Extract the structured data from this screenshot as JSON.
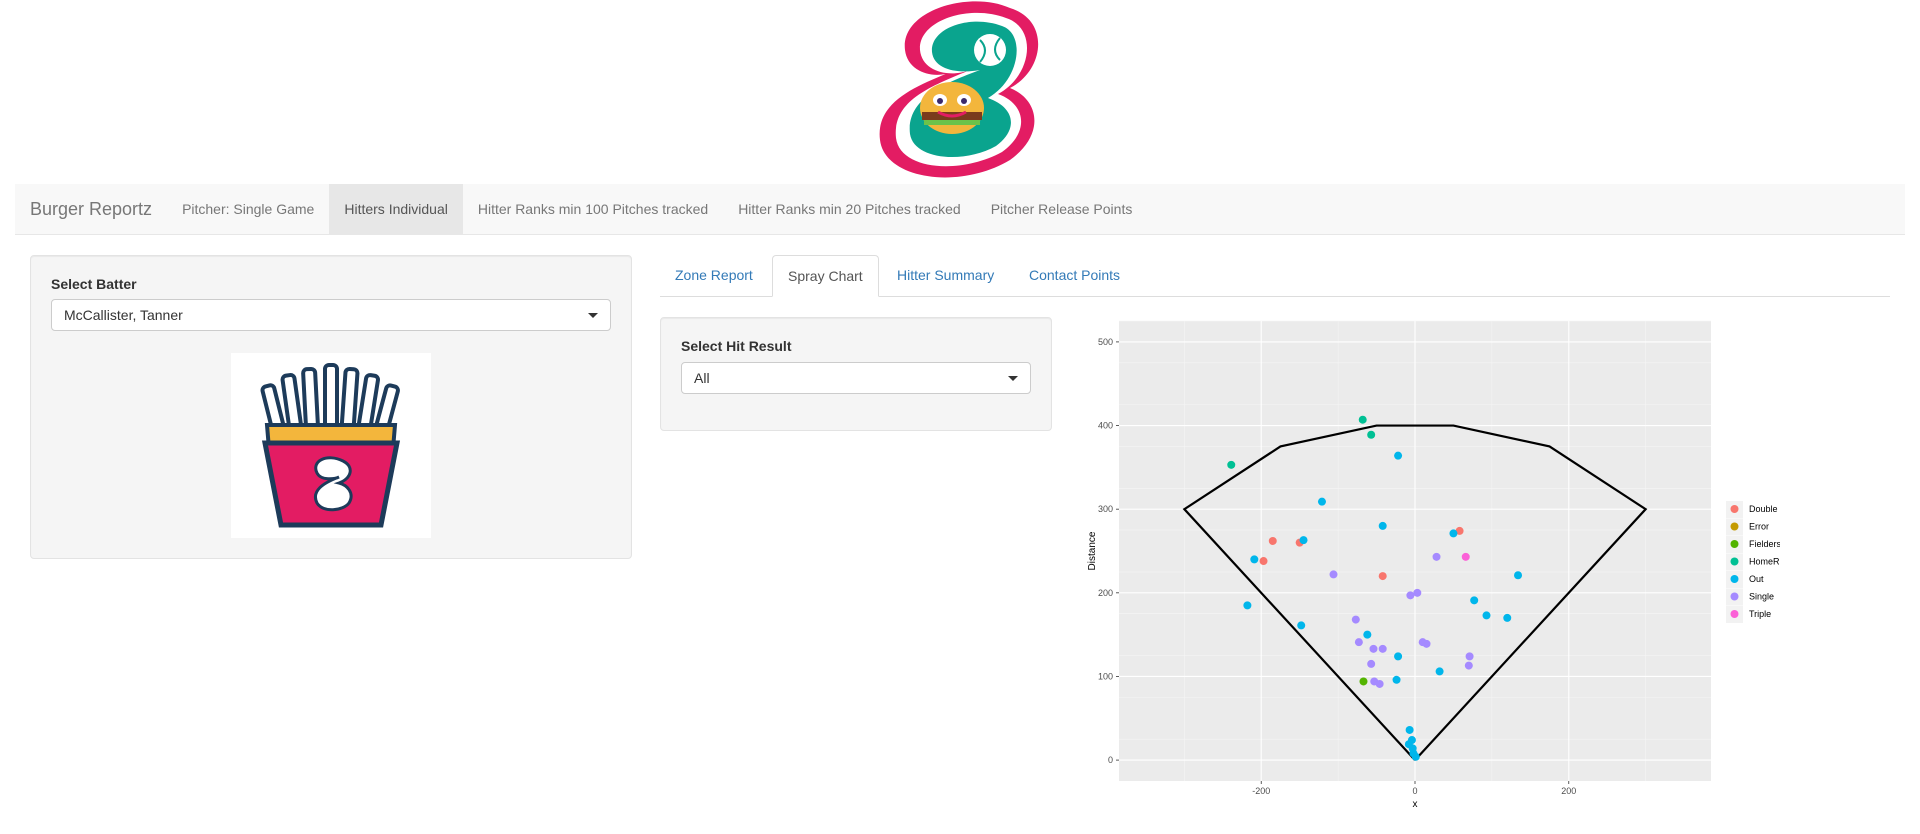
{
  "navbar": {
    "brand": "Burger Reportz",
    "items": [
      {
        "label": "Pitcher: Single Game",
        "active": false
      },
      {
        "label": "Hitters Individual",
        "active": true
      },
      {
        "label": "Hitter Ranks min 100 Pitches tracked",
        "active": false
      },
      {
        "label": "Hitter Ranks min 20 Pitches tracked",
        "active": false
      },
      {
        "label": "Pitcher Release Points",
        "active": false
      }
    ]
  },
  "sidebar": {
    "batter_label": "Select Batter",
    "batter_value": "McCallister, Tanner"
  },
  "tabs": [
    "Zone Report",
    "Spray Chart",
    "Hitter Summary",
    "Contact Points"
  ],
  "active_tab": "Spray Chart",
  "filter": {
    "label": "Select Hit Result",
    "value": "All"
  },
  "colors": {
    "brand_pink": "#e31c63",
    "brand_teal": "#0aa48e",
    "link": "#337ab7",
    "navbar_bg": "#f8f8f8",
    "active_nav_bg": "#e7e7e7"
  },
  "chart_data": {
    "type": "scatter",
    "xlabel": "x",
    "ylabel": "Distance",
    "xlim": [
      -385,
      385
    ],
    "ylim": [
      -25,
      525
    ],
    "x_ticks": [
      -200,
      0,
      200
    ],
    "y_ticks": [
      0,
      100,
      200,
      300,
      400,
      500
    ],
    "grid": true,
    "legend_position": "right",
    "field_outline": [
      [
        0,
        0
      ],
      [
        -300,
        300
      ],
      [
        -175,
        375
      ],
      [
        -50,
        400
      ],
      [
        50,
        400
      ],
      [
        175,
        375
      ],
      [
        300,
        300
      ],
      [
        0,
        0
      ]
    ],
    "series": [
      {
        "name": "Double",
        "color": "#F8766D",
        "points": [
          [
            -185,
            262
          ],
          [
            -197,
            238
          ],
          [
            -150,
            260
          ],
          [
            -42,
            220
          ],
          [
            58,
            274
          ]
        ]
      },
      {
        "name": "Error",
        "color": "#C49A00",
        "points": []
      },
      {
        "name": "FieldersChoice",
        "color": "#53B400",
        "points": [
          [
            -67,
            94
          ]
        ]
      },
      {
        "name": "HomeRun",
        "color": "#00C094",
        "points": [
          [
            -68,
            407
          ],
          [
            -57,
            389
          ],
          [
            -239,
            353
          ]
        ]
      },
      {
        "name": "Out",
        "color": "#00B6EB",
        "points": [
          [
            -22,
            364
          ],
          [
            -121,
            309
          ],
          [
            -42,
            280
          ],
          [
            -145,
            263
          ],
          [
            -209,
            240
          ],
          [
            50,
            271
          ],
          [
            -218,
            185
          ],
          [
            -148,
            161
          ],
          [
            -62,
            150
          ],
          [
            -22,
            124
          ],
          [
            -24,
            96
          ],
          [
            32,
            106
          ],
          [
            77,
            191
          ],
          [
            93,
            173
          ],
          [
            120,
            170
          ],
          [
            134,
            221
          ],
          [
            -7,
            36
          ],
          [
            -4,
            24
          ],
          [
            -8,
            19
          ],
          [
            -3,
            14
          ],
          [
            -2,
            8
          ],
          [
            1,
            4
          ]
        ]
      },
      {
        "name": "Single",
        "color": "#A58AFF",
        "points": [
          [
            -106,
            222
          ],
          [
            28,
            243
          ],
          [
            -6,
            197
          ],
          [
            3,
            200
          ],
          [
            -77,
            168
          ],
          [
            -73,
            141
          ],
          [
            -54,
            133
          ],
          [
            -42,
            133
          ],
          [
            10,
            141
          ],
          [
            15,
            139
          ],
          [
            -57,
            115
          ],
          [
            71,
            124
          ],
          [
            70,
            113
          ],
          [
            -53,
            94
          ],
          [
            -46,
            91
          ]
        ]
      },
      {
        "name": "Triple",
        "color": "#FB61D7",
        "points": [
          [
            66,
            243
          ]
        ]
      }
    ]
  }
}
